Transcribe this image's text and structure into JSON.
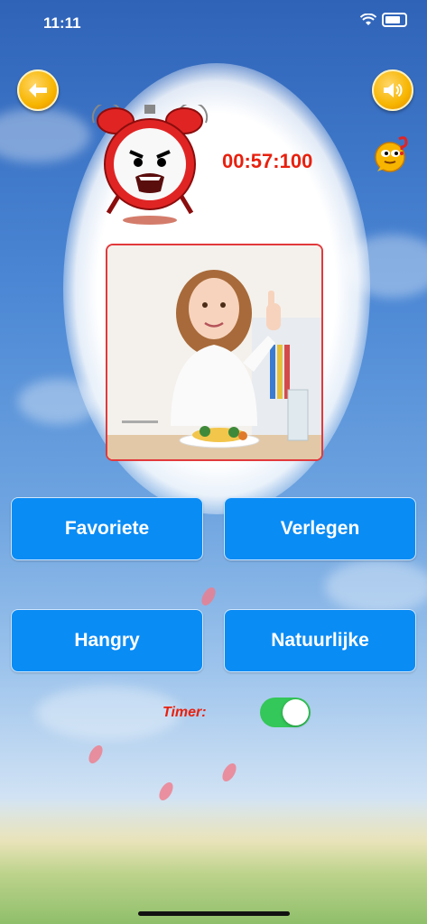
{
  "status_bar": {
    "time": "11:11"
  },
  "header": {
    "back_icon": "arrow-left-icon",
    "sound_icon": "speaker-icon",
    "hint_icon": "question-bubble-icon"
  },
  "game": {
    "countdown": "00:57:100",
    "clock_icon": "alarm-clock-icon",
    "picture_icon": "girl-thumbs-up-picture"
  },
  "answers": [
    {
      "label": "Favoriete"
    },
    {
      "label": "Verlegen"
    },
    {
      "label": "Hangry"
    },
    {
      "label": "Natuurlijke"
    }
  ],
  "timer_setting": {
    "label": "Timer:",
    "enabled": true
  },
  "colors": {
    "answer_button": "#0a8cf5",
    "timer_text": "#e8200e",
    "round_button": "#f7b500",
    "toggle_on": "#34c759",
    "photo_border": "#e2393c"
  }
}
